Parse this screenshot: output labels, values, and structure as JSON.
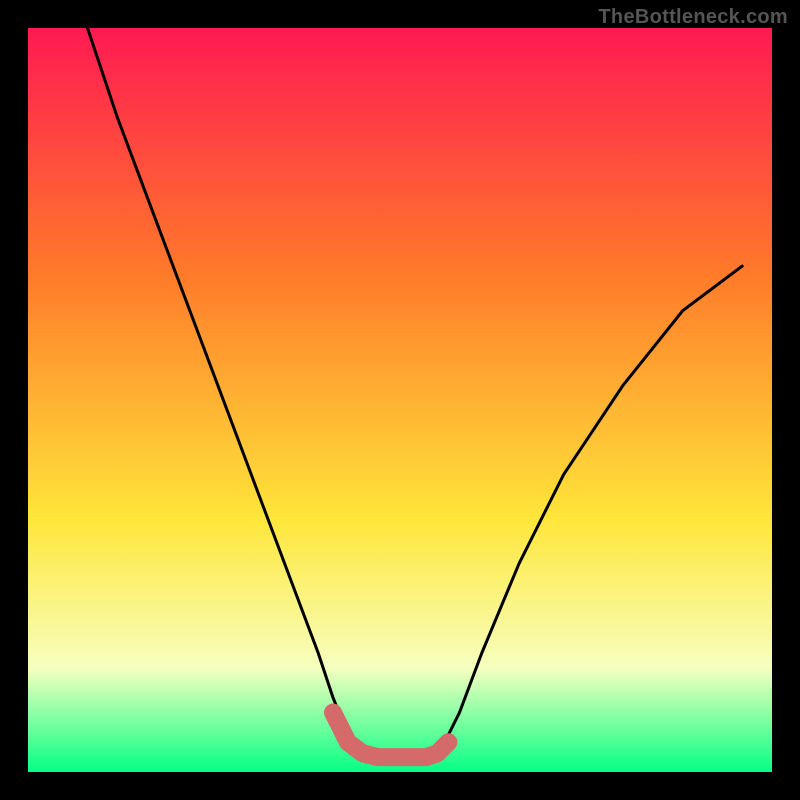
{
  "watermark": "TheBottleneck.com",
  "colors": {
    "gradient_top": "#ff1a52",
    "gradient_mid1": "#ff7a2a",
    "gradient_mid2": "#ffe63a",
    "gradient_pale": "#f6ffbf",
    "gradient_bottom": "#06ff85",
    "border": "#000000",
    "curve": "#000000",
    "highlight": "#d46a6a"
  },
  "chart_data": {
    "type": "line",
    "title": "",
    "xlabel": "",
    "ylabel": "",
    "xlim": [
      0,
      100
    ],
    "ylim": [
      0,
      100
    ],
    "categories_note": "x is normalized horizontal position (0-100 left→right); y is normalized vertical value where 0=bottom and 100=top, estimated from pixel positions.",
    "series": [
      {
        "name": "black-curve",
        "x": [
          8,
          12,
          18,
          24,
          30,
          36,
          39,
          41,
          43,
          45,
          47,
          49.5,
          52,
          53.5,
          55,
          56.5,
          58,
          61,
          66,
          72,
          80,
          88,
          96
        ],
        "y": [
          100,
          88,
          72,
          56,
          40,
          24,
          16,
          10,
          5,
          3,
          2,
          2,
          2,
          2,
          3,
          5,
          8,
          16,
          28,
          40,
          52,
          62,
          68
        ]
      },
      {
        "name": "highlight-segment",
        "x": [
          41,
          43,
          45,
          47,
          49.5,
          52,
          53.5,
          55,
          56.5
        ],
        "y": [
          8,
          4,
          2.5,
          2,
          2,
          2,
          2,
          2.5,
          4
        ]
      }
    ]
  }
}
